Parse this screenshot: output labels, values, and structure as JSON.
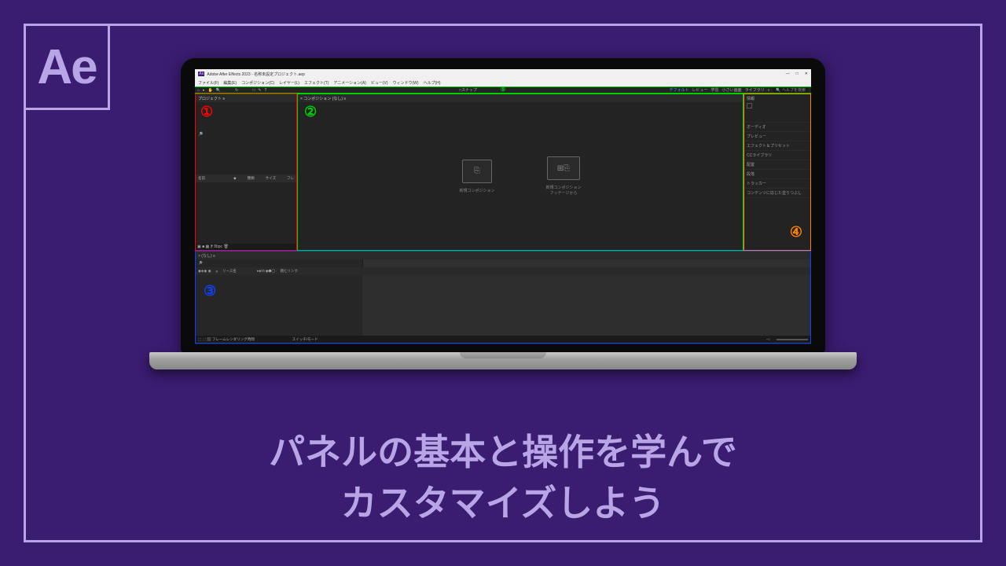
{
  "logo": "Ae",
  "app": {
    "title": "Adobe After Effects 2023 - 名称未設定プロジェクト.aep",
    "menu": [
      "ファイル(F)",
      "編集(E)",
      "コンポジション(C)",
      "レイヤー(L)",
      "エフェクト(T)",
      "アニメーション(A)",
      "ビュー(V)",
      "ウィンドウ(W)",
      "ヘルプ(H)"
    ]
  },
  "toolbar": {
    "snap": "□スナップ",
    "workspace": "デフォルト",
    "search_placeholder": "ヘルプを検索",
    "labels": [
      "レビュー",
      "学習",
      "小さい画面",
      "ライブラリ"
    ]
  },
  "markers": {
    "1": "①",
    "2": "②",
    "3": "③",
    "4": "④",
    "5": "⑤"
  },
  "project": {
    "tab": "プロジェクト ≡",
    "columns": {
      "name": "名前",
      "type": "種類",
      "size": "サイズ",
      "fr": "フレ"
    },
    "footer_icons": "▣ ■ ▦ ⁋ 8bpc 🗑"
  },
  "composition": {
    "tab": "× コンポジション (なし) ≡",
    "new_comp": "新規コンポジション",
    "new_from_footage": "新規コンポジション\nフッテージから"
  },
  "side": {
    "info_label": "情報",
    "panels": [
      "オーディオ",
      "プレビュー",
      "エフェクト＆プリセット",
      "CCライブラリ",
      "配置",
      "段落",
      "トラッカー",
      "コンテンツに応じた塗りつぶし"
    ]
  },
  "timeline": {
    "tab": "× (なし) ≡",
    "cols": {
      "idx": "#",
      "source": "ソース名",
      "switches": "♦◈\\↻◉⬢◯",
      "parent": "親とリンク"
    },
    "footer": {
      "left": "⬚ ⬚ ⬛ フレームレンダリング時間",
      "mode": "スイッチ/モード"
    }
  },
  "heading": {
    "line1": "パネルの基本と操作を学んで",
    "line2": "カスタマイズしよう"
  }
}
